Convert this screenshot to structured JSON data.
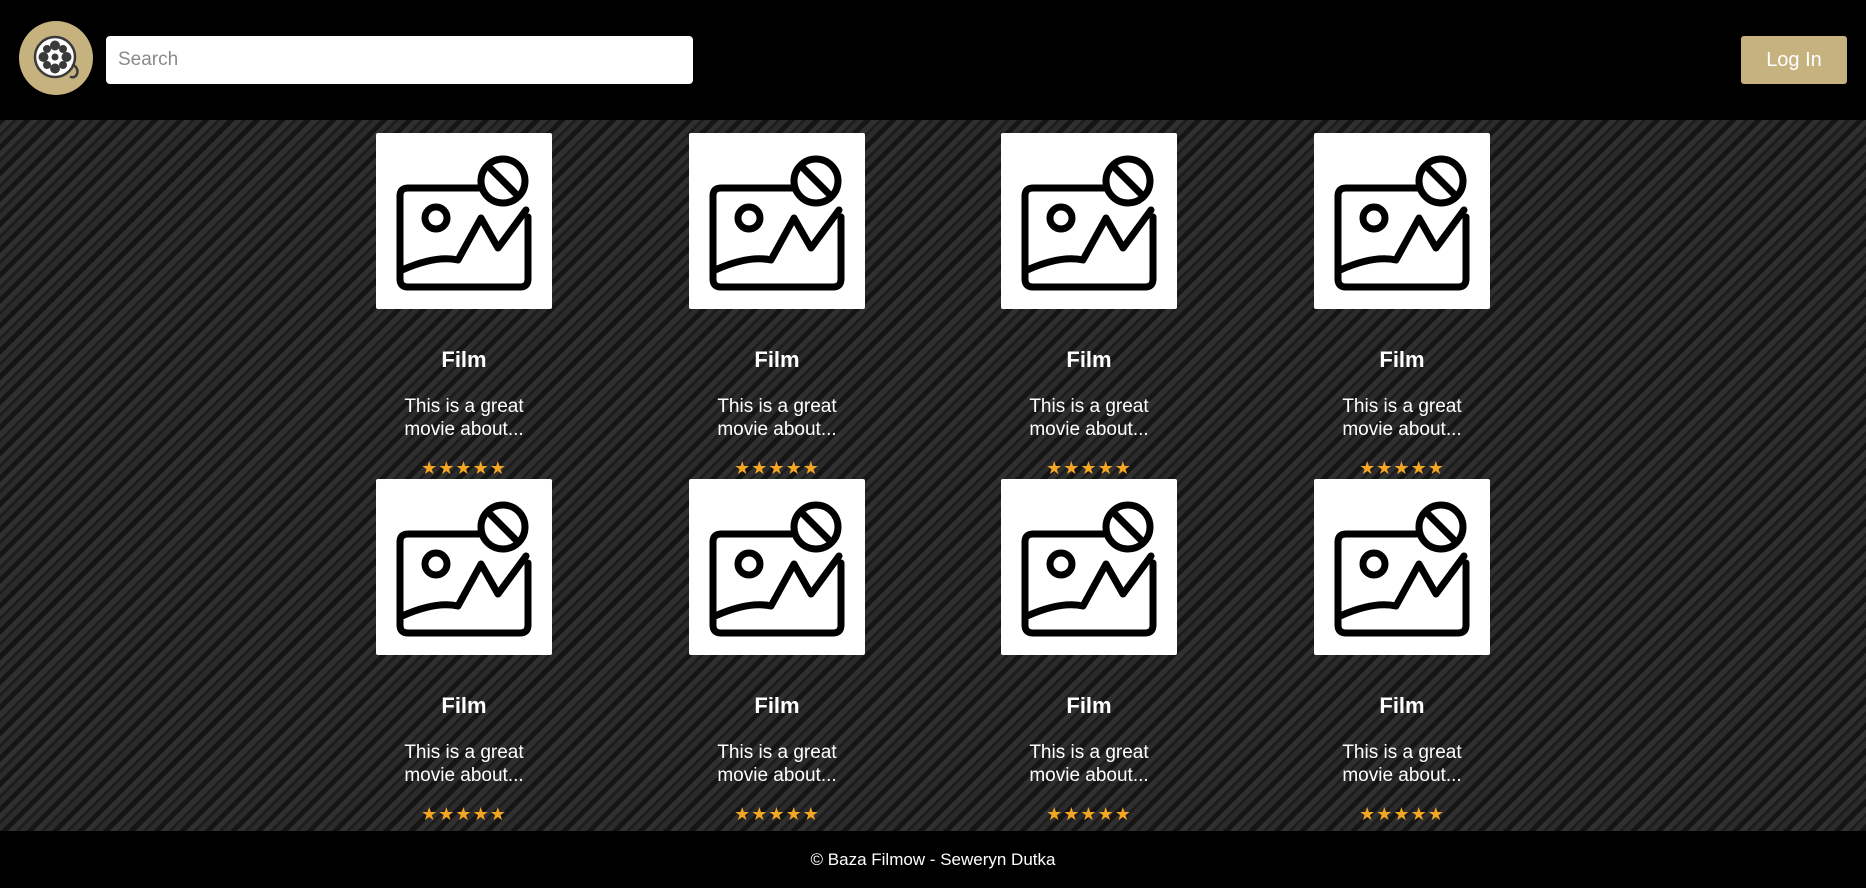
{
  "header": {
    "logo_icon": "film-reel-icon",
    "search_placeholder": "Search",
    "login_label": "Log In",
    "accent_color": "#c6b27e"
  },
  "films": [
    {
      "title": "Film",
      "description": "This is a great movie about...",
      "stars": "★★★★★",
      "rating": 5,
      "image_icon": "image-unavailable-icon"
    },
    {
      "title": "Film",
      "description": "This is a great movie about...",
      "stars": "★★★★★",
      "rating": 5,
      "image_icon": "image-unavailable-icon"
    },
    {
      "title": "Film",
      "description": "This is a great movie about...",
      "stars": "★★★★★",
      "rating": 5,
      "image_icon": "image-unavailable-icon"
    },
    {
      "title": "Film",
      "description": "This is a great movie about...",
      "stars": "★★★★★",
      "rating": 5,
      "image_icon": "image-unavailable-icon"
    },
    {
      "title": "Film",
      "description": "This is a great movie about...",
      "stars": "★★★★★",
      "rating": 5,
      "image_icon": "image-unavailable-icon"
    },
    {
      "title": "Film",
      "description": "This is a great movie about...",
      "stars": "★★★★★",
      "rating": 5,
      "image_icon": "image-unavailable-icon"
    },
    {
      "title": "Film",
      "description": "This is a great movie about...",
      "stars": "★★★★★",
      "rating": 5,
      "image_icon": "image-unavailable-icon"
    },
    {
      "title": "Film",
      "description": "This is a great movie about...",
      "stars": "★★★★★",
      "rating": 5,
      "image_icon": "image-unavailable-icon"
    }
  ],
  "footer": {
    "text": "© Baza Filmow - Seweryn Dutka"
  },
  "colors": {
    "star": "#f5a623",
    "header_bg": "#000000"
  }
}
